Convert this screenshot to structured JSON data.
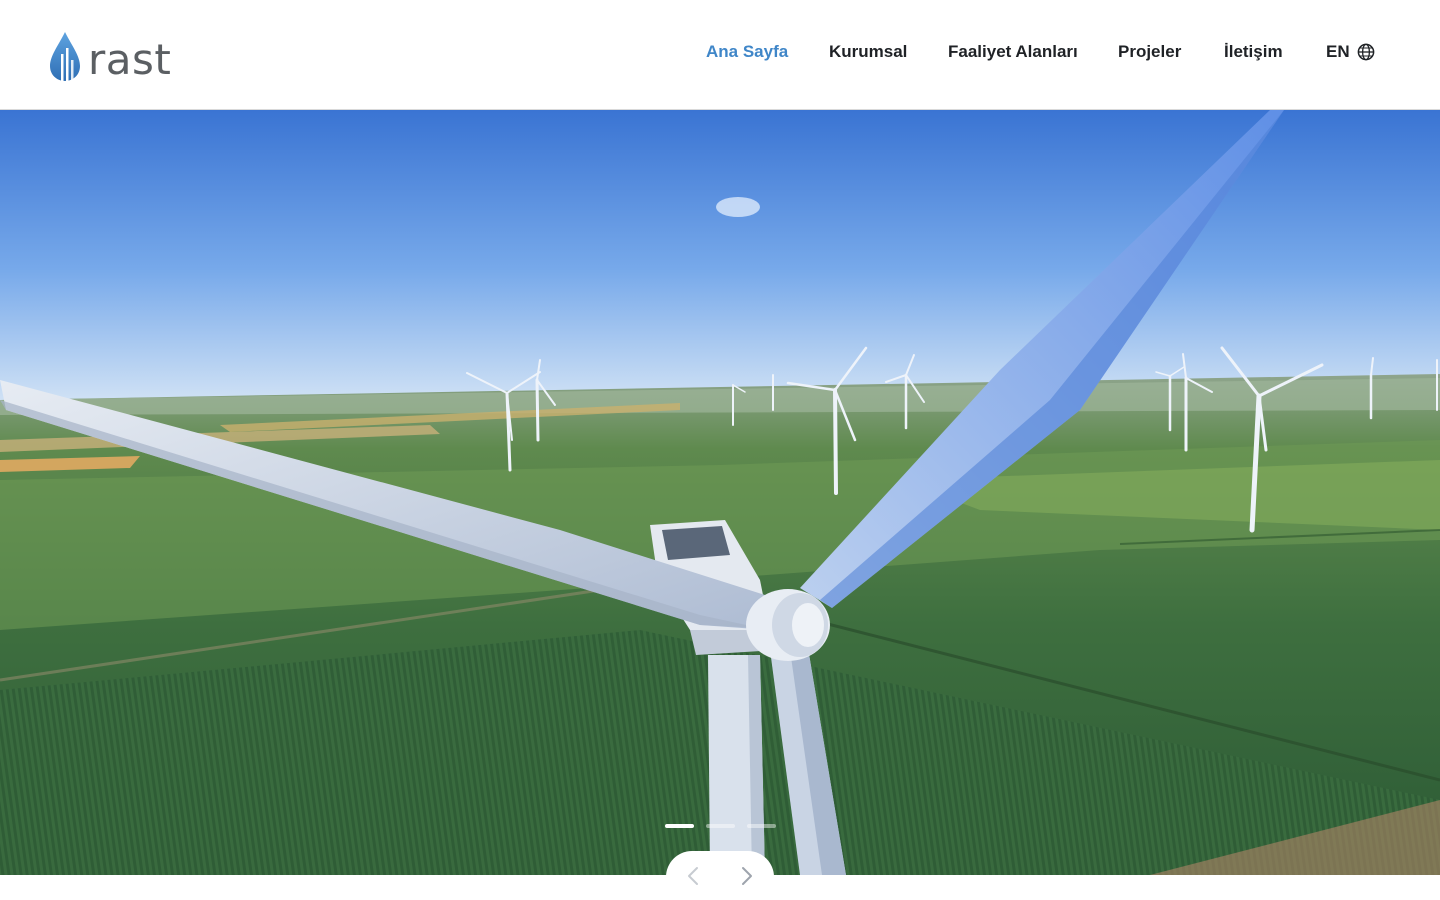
{
  "brand": {
    "name": "rast",
    "color": "#3f86c8",
    "text_color": "#5b5f63"
  },
  "nav": {
    "items": [
      {
        "label": "Ana Sayfa",
        "active": true
      },
      {
        "label": "Kurumsal",
        "active": false
      },
      {
        "label": "Faaliyet Alanları",
        "active": false
      },
      {
        "label": "Projeler",
        "active": false
      },
      {
        "label": "İletişim",
        "active": false
      }
    ],
    "language": {
      "label": "EN",
      "icon": "globe-icon"
    }
  },
  "slider": {
    "slide_count": 3,
    "active_slide": 1,
    "prev_icon": "chevron-left-icon",
    "next_icon": "chevron-right-icon"
  },
  "colors": {
    "active_nav": "#3f86c8",
    "nav_text": "#1f2226",
    "sky_top": "#3c78d6",
    "field": "#3e6b3f"
  }
}
